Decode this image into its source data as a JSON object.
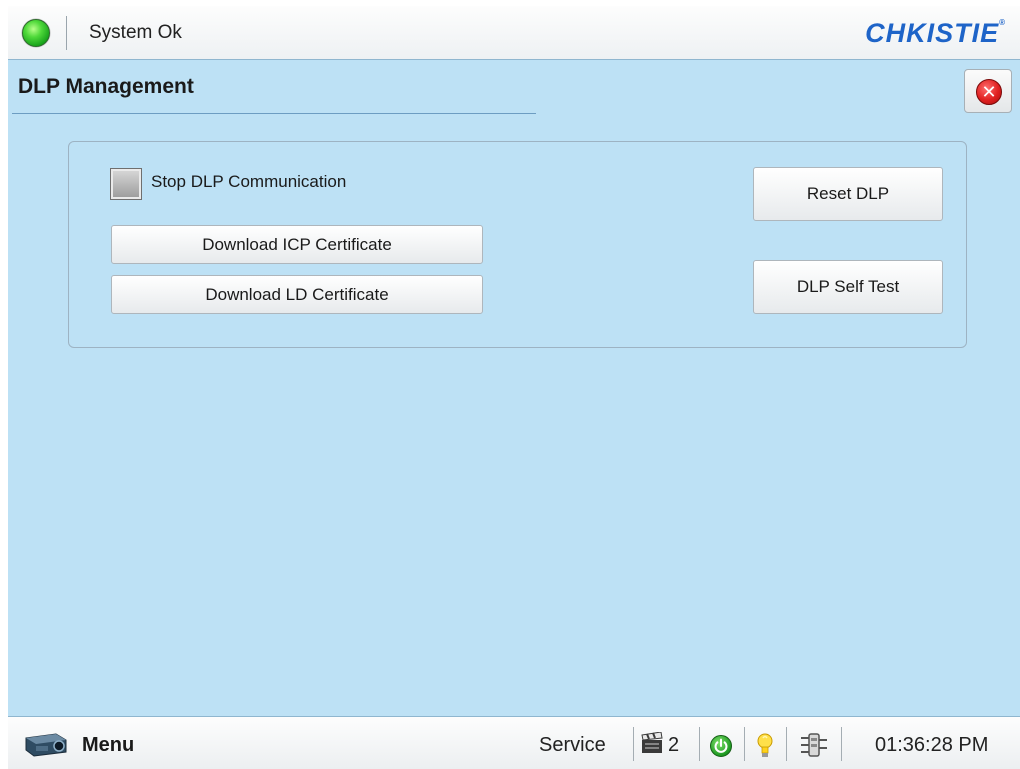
{
  "header": {
    "status_text": "System Ok",
    "brand": "CHKISTIE",
    "status_color": "#2ecc2e",
    "brand_color": "#1e64c8"
  },
  "page": {
    "title": "DLP Management",
    "close_icon": "close-icon"
  },
  "panel": {
    "stop_communication_label": "Stop DLP Communication",
    "stop_communication_checked": false,
    "download_icp_label": "Download ICP Certificate",
    "download_ld_label": "Download LD Certificate",
    "reset_dlp_label": "Reset DLP",
    "self_test_label": "DLP Self Test"
  },
  "footer": {
    "menu_label": "Menu",
    "mode_label": "Service",
    "channel": "2",
    "time": "01:36:28 PM",
    "icons": [
      "projector-icon",
      "clapper-icon",
      "power-icon",
      "bulb-icon",
      "network-icon"
    ]
  }
}
